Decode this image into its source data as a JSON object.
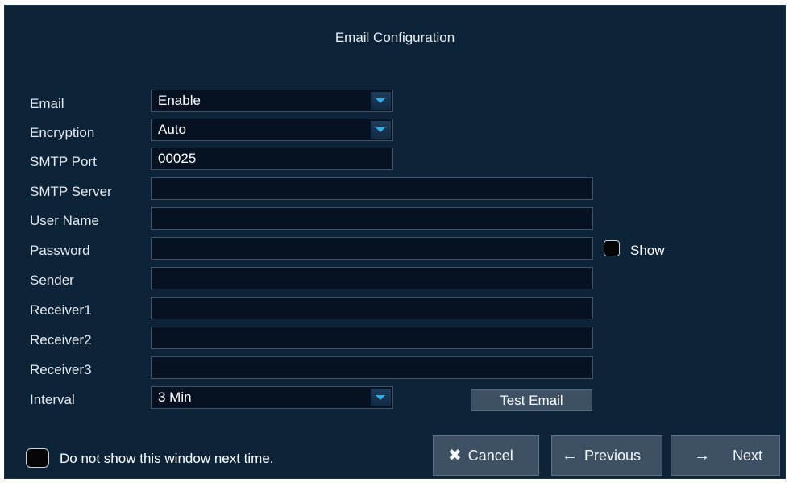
{
  "dialog": {
    "title": "Email Configuration"
  },
  "form": {
    "email": {
      "label": "Email",
      "value": "Enable"
    },
    "encryption": {
      "label": "Encryption",
      "value": "Auto"
    },
    "smtp_port": {
      "label": "SMTP Port",
      "value": "00025"
    },
    "smtp_server": {
      "label": "SMTP Server",
      "value": ""
    },
    "user_name": {
      "label": "User Name",
      "value": ""
    },
    "password": {
      "label": "Password",
      "value": "",
      "show_label": "Show"
    },
    "sender": {
      "label": "Sender",
      "value": ""
    },
    "receiver1": {
      "label": "Receiver1",
      "value": ""
    },
    "receiver2": {
      "label": "Receiver2",
      "value": ""
    },
    "receiver3": {
      "label": "Receiver3",
      "value": ""
    },
    "interval": {
      "label": "Interval",
      "value": "3 Min"
    }
  },
  "buttons": {
    "test_email": "Test Email",
    "cancel": "Cancel",
    "previous": "Previous",
    "next": "Next"
  },
  "icons": {
    "cancel": "x-icon",
    "previous": "arrow-left-icon",
    "next": "arrow-right-icon"
  },
  "footer": {
    "do_not_show_label": "Do not show this window next time."
  },
  "colors": {
    "background": "#0d2338",
    "field": "#061222",
    "button": "#3d5064",
    "accent": "#3fa9e6"
  }
}
